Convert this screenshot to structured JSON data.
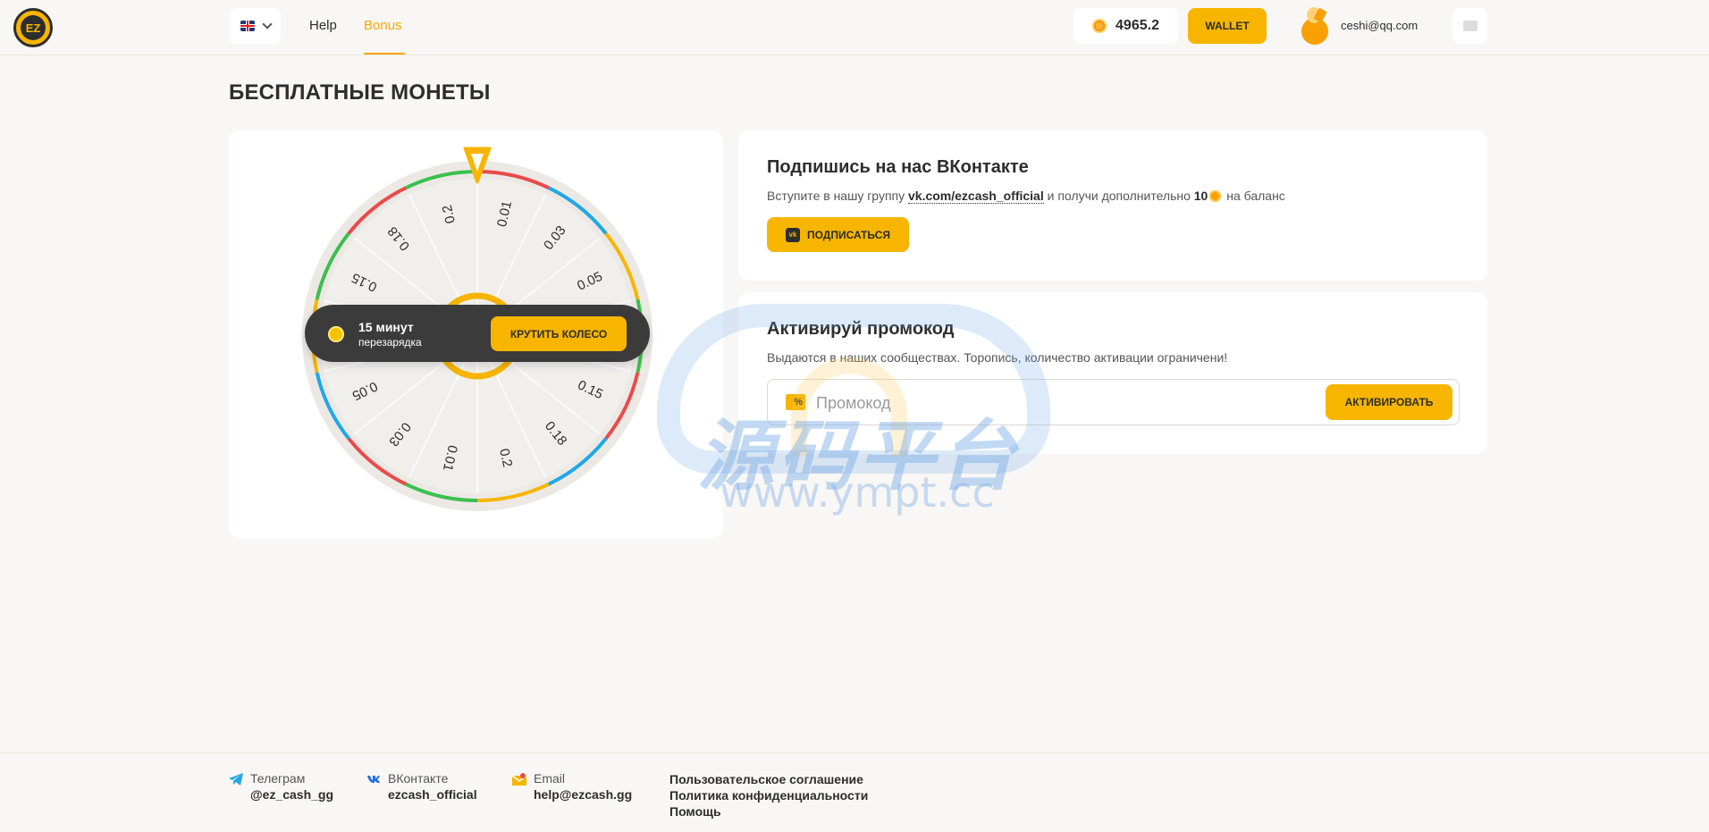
{
  "header": {
    "logo_text": "EZ",
    "nav": {
      "help": "Help",
      "bonus": "Bonus"
    },
    "balance": "4965.2",
    "wallet_label": "WALLET",
    "user_email": "ceshi@qq.com"
  },
  "page_title": "БЕСПЛАТНЫЕ МОНЕТЫ",
  "wheel": {
    "segments": [
      "0.01",
      "0.03",
      "0.05",
      "0.1",
      "0.15",
      "0.18",
      "0.2",
      "0.01",
      "0.03",
      "0.05",
      "0.1",
      "0.15",
      "0.18",
      "0.2"
    ],
    "segment_colors": [
      "#ea4a4a",
      "#1fa8e8",
      "#f7b500",
      "#3cbf4f",
      "#ea4a4a",
      "#1fa8e8",
      "#f7b500",
      "#3cbf4f",
      "#ea4a4a",
      "#1fa8e8",
      "#f7b500",
      "#3cbf4f",
      "#ea4a4a",
      "#3cbf4f"
    ],
    "cooldown_time": "15 минут",
    "cooldown_label": "перезарядка",
    "spin_label": "КРУТИТЬ КОЛЕСО"
  },
  "vk_card": {
    "title": "Подпишись на нас ВКонтакте",
    "text_before": "Вступите в нашу группу ",
    "link": "vk.com/ezcash_official",
    "text_middle": " и получи дополнительно ",
    "bonus_amount": "10",
    "text_after": " на баланс",
    "subscribe_label": "ПОДПИСАТЬСЯ",
    "vk_icon_text": "vk"
  },
  "promo_card": {
    "title": "Активируй промокод",
    "text": "Выдаются в наших сообществах. Торопись, количество активации ограничени!",
    "placeholder": "Промокод",
    "value": "",
    "promo_icon_text": "%",
    "activate_label": "АКТИВИРОВАТЬ"
  },
  "watermark": {
    "cn": "源码平台",
    "url": "www.ympt.cc"
  },
  "footer": {
    "telegram": {
      "label": "Телеграм",
      "value": "@ez_cash_gg"
    },
    "vk": {
      "label": "ВКонтакте",
      "value": "ezcash_official"
    },
    "email": {
      "label": "Email",
      "value": "help@ezcash.gg"
    },
    "links": [
      "Пользовательское соглашение",
      "Политика конфиденциальности",
      "Помощь"
    ]
  },
  "colors": {
    "accent": "#f7b500",
    "dark": "#2d2d2d",
    "background": "#f8f7f5"
  }
}
